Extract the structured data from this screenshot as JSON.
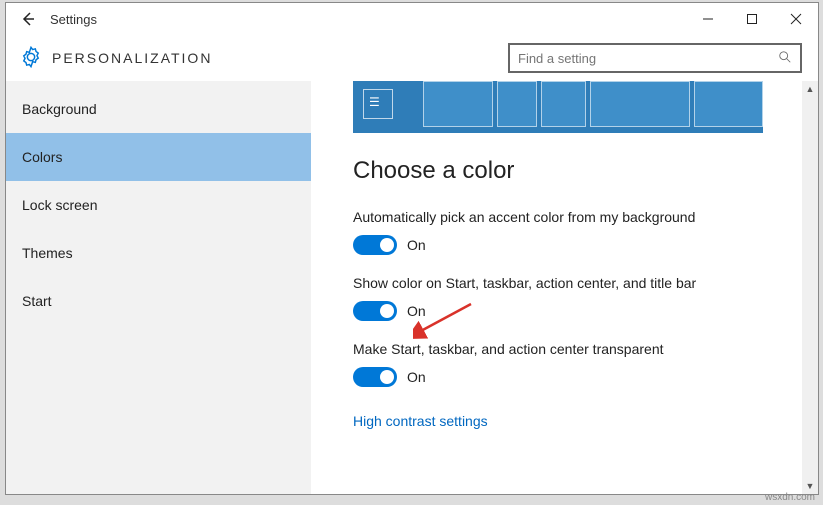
{
  "window": {
    "title": "Settings"
  },
  "header": {
    "category": "PERSONALIZATION",
    "search_placeholder": "Find a setting"
  },
  "sidebar": {
    "items": [
      {
        "label": "Background",
        "selected": false
      },
      {
        "label": "Colors",
        "selected": true
      },
      {
        "label": "Lock screen",
        "selected": false
      },
      {
        "label": "Themes",
        "selected": false
      },
      {
        "label": "Start",
        "selected": false
      }
    ]
  },
  "content": {
    "section_title": "Choose a color",
    "settings": [
      {
        "label": "Automatically pick an accent color from my background",
        "state": "On"
      },
      {
        "label": "Show color on Start, taskbar, action center, and title bar",
        "state": "On"
      },
      {
        "label": "Make Start, taskbar, and action center transparent",
        "state": "On"
      }
    ],
    "link": "High contrast settings"
  },
  "colors": {
    "accent": "#0078D7",
    "sidebar_selected": "#91C0E8",
    "link": "#0067C0"
  },
  "watermark": "wsxdn.com"
}
